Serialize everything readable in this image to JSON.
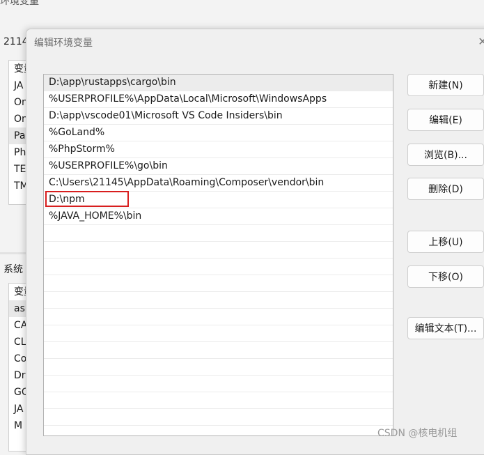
{
  "background": {
    "window_title": "环境变量",
    "user_vars_label": "2114",
    "user_vars_items": [
      "变量",
      "JA",
      "On",
      "On",
      "Pa",
      "Ph",
      "TE",
      "TM"
    ],
    "system_vars_label": "系统",
    "system_vars_items": [
      "变量",
      "asl",
      "CA",
      "CL",
      "Co",
      "Dr",
      "GO",
      "JA",
      "M"
    ]
  },
  "dialog": {
    "title": "编辑环境变量",
    "close_glyph": "✕",
    "paths": [
      "D:\\app\\rustapps\\cargo\\bin",
      "%USERPROFILE%\\AppData\\Local\\Microsoft\\WindowsApps",
      "D:\\app\\vscode01\\Microsoft VS Code Insiders\\bin",
      "%GoLand%",
      "%PhpStorm%",
      "%USERPROFILE%\\go\\bin",
      "C:\\Users\\21145\\AppData\\Roaming\\Composer\\vendor\\bin",
      "D:\\npm",
      "%JAVA_HOME%\\bin"
    ],
    "buttons": {
      "new": "新建(N)",
      "edit": "编辑(E)",
      "browse": "浏览(B)...",
      "delete": "删除(D)",
      "move_up": "上移(U)",
      "move_down": "下移(O)",
      "edit_text": "编辑文本(T)..."
    }
  },
  "watermark": "CSDN @核电机组"
}
